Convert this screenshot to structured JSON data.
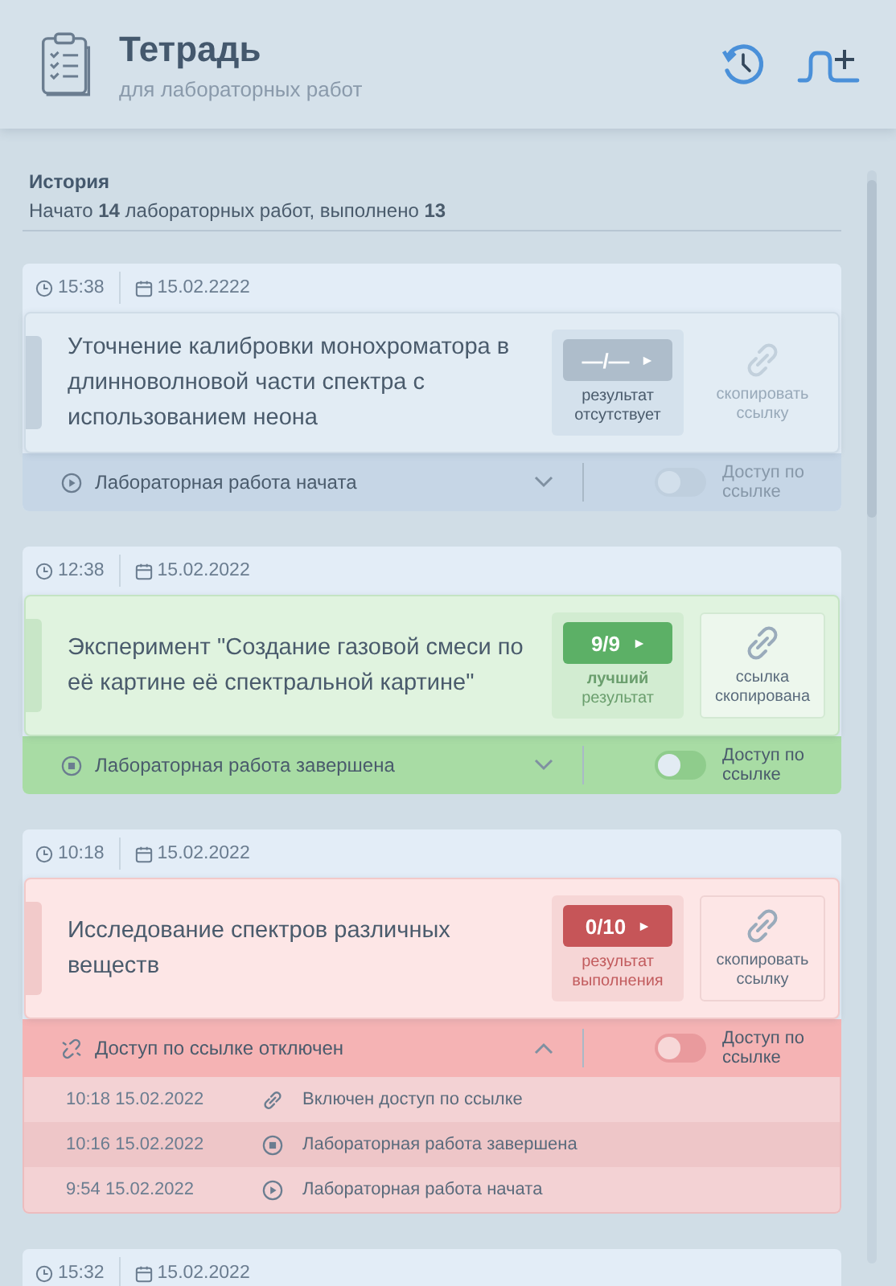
{
  "header": {
    "title": "Тетрадь",
    "subtitle": "для лабораторных работ"
  },
  "history": {
    "title": "История",
    "summary": "Начато **14** лабораторных работ, выполнено **13**"
  },
  "works": [
    {
      "time": "15:38",
      "date": "15.02.2222",
      "title": "Уточнение калибровки монохроматора в длинноволновой части спектра с использованием неона",
      "kind": "empty",
      "score": "—/—",
      "result_label": "результат отсутствует",
      "link_label": "скопировать ссылку",
      "link_disabled": true,
      "event": {
        "kind": "play",
        "text": "Лабораторная работа начата"
      },
      "expanded": false,
      "access_on": false,
      "access_disabled": true,
      "access_label": "Доступ по ссылке"
    },
    {
      "time": "12:38",
      "date": "15.02.2022",
      "title": "Эксперимент \"Создание газовой смеси по её картине её спектральной картине\"",
      "kind": "success",
      "score": "9/9",
      "result_label": "**лучший** результат",
      "link_label": "ссылка скопирована",
      "link_disabled": false,
      "event": {
        "kind": "stop",
        "text": "Лабораторная работа завершена"
      },
      "expanded": false,
      "access_on": false,
      "access_disabled": false,
      "access_label": "Доступ по ссылке"
    },
    {
      "time": "10:18",
      "date": "15.02.2022",
      "title": "Исследование спектров различных веществ",
      "kind": "fail",
      "score": "0/10",
      "result_label": "результат выполнения",
      "link_label": "скопировать ссылку",
      "link_disabled": false,
      "event": {
        "kind": "unlink",
        "text": "Доступ по ссылке отключен"
      },
      "expanded": true,
      "access_on": false,
      "access_disabled": false,
      "access_label": "Доступ по ссылке",
      "log": [
        {
          "when": "10:18 15.02.2022",
          "kind": "link",
          "text": "Включен доступ по ссылке",
          "selected": false
        },
        {
          "when": "10:16 15.02.2022",
          "kind": "stop",
          "text": "Лабораторная работа завершена",
          "selected": true
        },
        {
          "when": "9:54 15.02.2022",
          "kind": "play",
          "text": "Лабораторная работа начата",
          "selected": false
        }
      ]
    },
    {
      "time": "15:32",
      "date": "15.02.2022"
    }
  ]
}
